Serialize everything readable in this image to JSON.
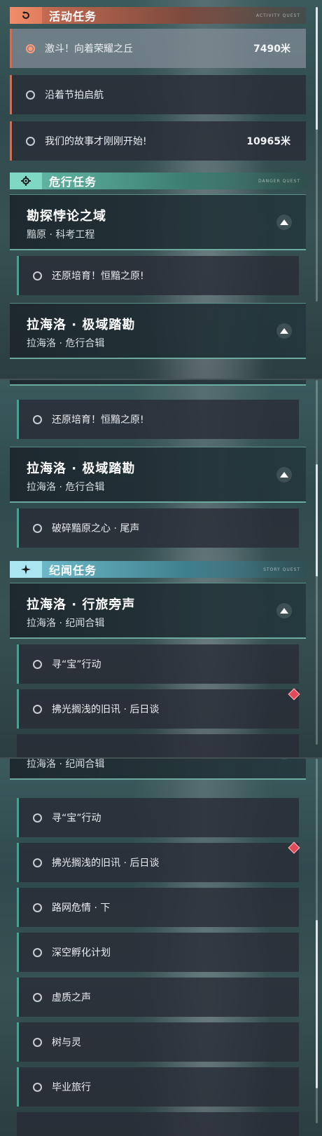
{
  "sections": {
    "activity": {
      "title": "活动任务",
      "icon": "activity-refresh-icon",
      "deco": "ACTIVITY QUEST"
    },
    "danger": {
      "title": "危行任务",
      "icon": "gear-icon",
      "deco": "DANGER QUEST"
    },
    "story": {
      "title": "纪闻任务",
      "icon": "sparkle-icon",
      "deco": "STORY QUEST"
    }
  },
  "activity_tasks": [
    {
      "label": "激斗！向着荣耀之丘",
      "distance": "7490米",
      "selected": true
    },
    {
      "label": "沿着节拍启航",
      "distance": ""
    },
    {
      "label": "我们的故事才刚刚开始!",
      "distance": "10965米"
    }
  ],
  "cards": {
    "kantan": {
      "title": "勘探悖论之域",
      "subtitle": "黯原 · 科考工程"
    },
    "lahailuo_jiyu": {
      "title": "拉海洛 · 极域踏勘",
      "subtitle": "拉海洛 · 危行合辑"
    },
    "lahailuo_xinglv": {
      "title": "拉海洛 · 行旅旁声",
      "subtitle": "拉海洛 · 纪闻合辑"
    }
  },
  "sub_tasks": {
    "huanyuan": "还原培育！恒黯之原!",
    "posui": "破碎黯原之心 · 尾声",
    "xunbao": "寻“宝”行动",
    "fuguang": "拂光搁浅的旧讯 · 后日谈",
    "luwang": "路网危情 · 下",
    "shenkong": "深空孵化计划",
    "xuzhi": "虚质之声",
    "shuyuling": "树与灵",
    "biye": "毕业旅行"
  },
  "colors": {
    "activity": "#f08d6a",
    "danger": "#7fd8c3",
    "story": "#a9e6f2",
    "badge": "#e24a5a"
  }
}
